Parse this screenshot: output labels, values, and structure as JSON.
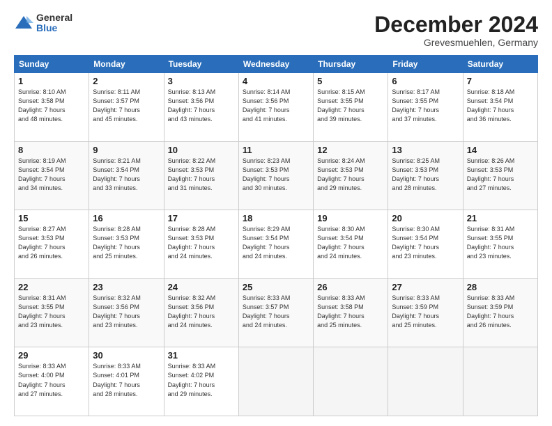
{
  "logo": {
    "general": "General",
    "blue": "Blue"
  },
  "header": {
    "month": "December 2024",
    "location": "Grevesmuehlen, Germany"
  },
  "weekdays": [
    "Sunday",
    "Monday",
    "Tuesday",
    "Wednesday",
    "Thursday",
    "Friday",
    "Saturday"
  ],
  "weeks": [
    [
      {
        "day": "1",
        "sunrise": "8:10 AM",
        "sunset": "3:58 PM",
        "daylight": "7 hours and 48 minutes."
      },
      {
        "day": "2",
        "sunrise": "8:11 AM",
        "sunset": "3:57 PM",
        "daylight": "7 hours and 45 minutes."
      },
      {
        "day": "3",
        "sunrise": "8:13 AM",
        "sunset": "3:56 PM",
        "daylight": "7 hours and 43 minutes."
      },
      {
        "day": "4",
        "sunrise": "8:14 AM",
        "sunset": "3:56 PM",
        "daylight": "7 hours and 41 minutes."
      },
      {
        "day": "5",
        "sunrise": "8:15 AM",
        "sunset": "3:55 PM",
        "daylight": "7 hours and 39 minutes."
      },
      {
        "day": "6",
        "sunrise": "8:17 AM",
        "sunset": "3:55 PM",
        "daylight": "7 hours and 37 minutes."
      },
      {
        "day": "7",
        "sunrise": "8:18 AM",
        "sunset": "3:54 PM",
        "daylight": "7 hours and 36 minutes."
      }
    ],
    [
      {
        "day": "8",
        "sunrise": "8:19 AM",
        "sunset": "3:54 PM",
        "daylight": "7 hours and 34 minutes."
      },
      {
        "day": "9",
        "sunrise": "8:21 AM",
        "sunset": "3:54 PM",
        "daylight": "7 hours and 33 minutes."
      },
      {
        "day": "10",
        "sunrise": "8:22 AM",
        "sunset": "3:53 PM",
        "daylight": "7 hours and 31 minutes."
      },
      {
        "day": "11",
        "sunrise": "8:23 AM",
        "sunset": "3:53 PM",
        "daylight": "7 hours and 30 minutes."
      },
      {
        "day": "12",
        "sunrise": "8:24 AM",
        "sunset": "3:53 PM",
        "daylight": "7 hours and 29 minutes."
      },
      {
        "day": "13",
        "sunrise": "8:25 AM",
        "sunset": "3:53 PM",
        "daylight": "7 hours and 28 minutes."
      },
      {
        "day": "14",
        "sunrise": "8:26 AM",
        "sunset": "3:53 PM",
        "daylight": "7 hours and 27 minutes."
      }
    ],
    [
      {
        "day": "15",
        "sunrise": "8:27 AM",
        "sunset": "3:53 PM",
        "daylight": "7 hours and 26 minutes."
      },
      {
        "day": "16",
        "sunrise": "8:28 AM",
        "sunset": "3:53 PM",
        "daylight": "7 hours and 25 minutes."
      },
      {
        "day": "17",
        "sunrise": "8:28 AM",
        "sunset": "3:53 PM",
        "daylight": "7 hours and 24 minutes."
      },
      {
        "day": "18",
        "sunrise": "8:29 AM",
        "sunset": "3:54 PM",
        "daylight": "7 hours and 24 minutes."
      },
      {
        "day": "19",
        "sunrise": "8:30 AM",
        "sunset": "3:54 PM",
        "daylight": "7 hours and 24 minutes."
      },
      {
        "day": "20",
        "sunrise": "8:30 AM",
        "sunset": "3:54 PM",
        "daylight": "7 hours and 23 minutes."
      },
      {
        "day": "21",
        "sunrise": "8:31 AM",
        "sunset": "3:55 PM",
        "daylight": "7 hours and 23 minutes."
      }
    ],
    [
      {
        "day": "22",
        "sunrise": "8:31 AM",
        "sunset": "3:55 PM",
        "daylight": "7 hours and 23 minutes."
      },
      {
        "day": "23",
        "sunrise": "8:32 AM",
        "sunset": "3:56 PM",
        "daylight": "7 hours and 23 minutes."
      },
      {
        "day": "24",
        "sunrise": "8:32 AM",
        "sunset": "3:56 PM",
        "daylight": "7 hours and 24 minutes."
      },
      {
        "day": "25",
        "sunrise": "8:33 AM",
        "sunset": "3:57 PM",
        "daylight": "7 hours and 24 minutes."
      },
      {
        "day": "26",
        "sunrise": "8:33 AM",
        "sunset": "3:58 PM",
        "daylight": "7 hours and 25 minutes."
      },
      {
        "day": "27",
        "sunrise": "8:33 AM",
        "sunset": "3:59 PM",
        "daylight": "7 hours and 25 minutes."
      },
      {
        "day": "28",
        "sunrise": "8:33 AM",
        "sunset": "3:59 PM",
        "daylight": "7 hours and 26 minutes."
      }
    ],
    [
      {
        "day": "29",
        "sunrise": "8:33 AM",
        "sunset": "4:00 PM",
        "daylight": "7 hours and 27 minutes."
      },
      {
        "day": "30",
        "sunrise": "8:33 AM",
        "sunset": "4:01 PM",
        "daylight": "7 hours and 28 minutes."
      },
      {
        "day": "31",
        "sunrise": "8:33 AM",
        "sunset": "4:02 PM",
        "daylight": "7 hours and 29 minutes."
      },
      null,
      null,
      null,
      null
    ]
  ]
}
